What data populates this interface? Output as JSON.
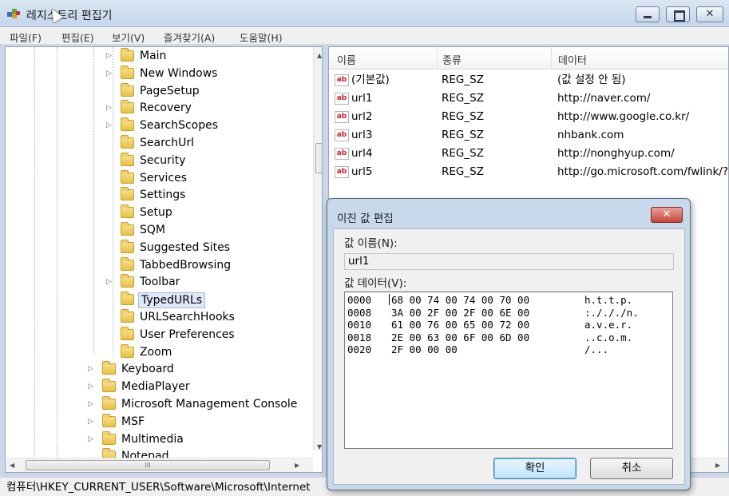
{
  "window": {
    "title": "레지스트리 편집기",
    "close_glyph": "✕"
  },
  "menu": [
    "파일(F)",
    "편집(E)",
    "보기(V)",
    "즐겨찾기(A)",
    "도움말(H)"
  ],
  "tree": {
    "items": [
      {
        "label": "Main",
        "expandable": true,
        "level": 2
      },
      {
        "label": "New Windows",
        "expandable": true,
        "level": 2
      },
      {
        "label": "PageSetup",
        "expandable": false,
        "level": 2
      },
      {
        "label": "Recovery",
        "expandable": true,
        "level": 2
      },
      {
        "label": "SearchScopes",
        "expandable": true,
        "level": 2
      },
      {
        "label": "SearchUrl",
        "expandable": false,
        "level": 2
      },
      {
        "label": "Security",
        "expandable": false,
        "level": 2
      },
      {
        "label": "Services",
        "expandable": false,
        "level": 2
      },
      {
        "label": "Settings",
        "expandable": false,
        "level": 2
      },
      {
        "label": "Setup",
        "expandable": false,
        "level": 2
      },
      {
        "label": "SQM",
        "expandable": false,
        "level": 2
      },
      {
        "label": "Suggested Sites",
        "expandable": false,
        "level": 2
      },
      {
        "label": "TabbedBrowsing",
        "expandable": false,
        "level": 2
      },
      {
        "label": "Toolbar",
        "expandable": true,
        "level": 2
      },
      {
        "label": "TypedURLs",
        "expandable": false,
        "level": 2,
        "selected": true
      },
      {
        "label": "URLSearchHooks",
        "expandable": false,
        "level": 2
      },
      {
        "label": "User Preferences",
        "expandable": false,
        "level": 2
      },
      {
        "label": "Zoom",
        "expandable": false,
        "level": 2
      },
      {
        "label": "Keyboard",
        "expandable": true,
        "level": 1
      },
      {
        "label": "MediaPlayer",
        "expandable": true,
        "level": 1
      },
      {
        "label": "Microsoft Management Console",
        "expandable": true,
        "level": 1
      },
      {
        "label": "MSF",
        "expandable": true,
        "level": 1
      },
      {
        "label": "Multimedia",
        "expandable": true,
        "level": 1
      },
      {
        "label": "Notepad",
        "expandable": false,
        "level": 1
      }
    ],
    "hscroll_glyph": "III"
  },
  "list": {
    "columns": [
      "이름",
      "종류",
      "데이터"
    ],
    "rows": [
      {
        "name": "(기본값)",
        "type": "REG_SZ",
        "data": "(값 설정 안 됨)"
      },
      {
        "name": "url1",
        "type": "REG_SZ",
        "data": "http://naver.com/"
      },
      {
        "name": "url2",
        "type": "REG_SZ",
        "data": "http://www.google.co.kr/"
      },
      {
        "name": "url3",
        "type": "REG_SZ",
        "data": "nhbank.com"
      },
      {
        "name": "url4",
        "type": "REG_SZ",
        "data": "http://nonghyup.com/"
      },
      {
        "name": "url5",
        "type": "REG_SZ",
        "data": "http://go.microsoft.com/fwlink/?"
      }
    ],
    "icon_text": "ab"
  },
  "status": {
    "path": "컴퓨터\\HKEY_CURRENT_USER\\Software\\Microsoft\\Internet"
  },
  "dialog": {
    "title": "이진 값 편집",
    "close_glyph": "✕",
    "name_label": "값 이름(N):",
    "name_value": "url1",
    "data_label": "값 데이터(V):",
    "hex_rows": [
      {
        "offset": "0000",
        "bytes": "68 00 74 00 74 00 70 00",
        "ascii": "h.t.t.p."
      },
      {
        "offset": "0008",
        "bytes": "3A 00 2F 00 2F 00 6E 00",
        "ascii": ":./././n."
      },
      {
        "offset": "0010",
        "bytes": "61 00 76 00 65 00 72 00",
        "ascii": "a.v.e.r."
      },
      {
        "offset": "0018",
        "bytes": "2E 00 63 00 6F 00 6D 00",
        "ascii": "..c.o.m."
      },
      {
        "offset": "0020",
        "bytes": "2F 00 00 00",
        "ascii": "/..."
      }
    ],
    "ok_label": "확인",
    "cancel_label": "취소"
  }
}
